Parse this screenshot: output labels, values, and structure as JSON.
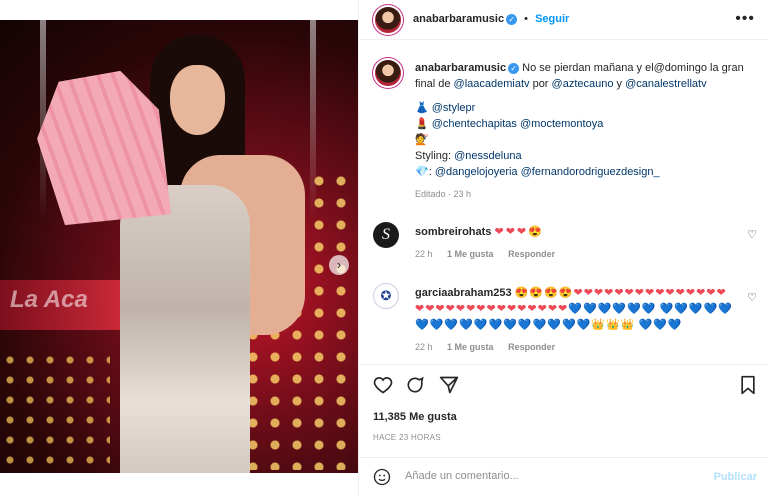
{
  "post": {
    "username": "anabarbaramusic",
    "follow_label": "Seguir",
    "more_icon": "more-horizontal-icon"
  },
  "caption": {
    "username": "anabarbaramusic",
    "text_parts": {
      "p1": "No se pierdan mañana y el@domingo la gran final de ",
      "m1": "@laacademiatv",
      "p2": " por ",
      "m2": "@aztecauno",
      "p3": " y ",
      "m3": "@canalestrellatv"
    },
    "line1_emoji": "👗",
    "line1_mention": "@stylepr",
    "line2_emoji": "💄",
    "line2_mention_a": "@chentechapitas",
    "line2_mention_b": "@moctemontoya",
    "line3_emoji": "💇",
    "styling_label": "Styling:",
    "styling_mention": "@nessdeluna",
    "line5_emoji": "💎",
    "line5_sep": ":",
    "line5_mention_a": "@dangelojoyeria",
    "line5_mention_b": "@fernandorodriguezdesign_",
    "edited": "Editado · 23 h"
  },
  "comments": [
    {
      "username": "sombreirohats",
      "text": "❤❤❤😍",
      "time": "22 h",
      "likes": "1 Me gusta",
      "reply": "Responder"
    },
    {
      "username": "garciaabraham253",
      "line1": "😍😍😍😍❤❤❤❤❤❤❤❤❤❤❤❤❤❤❤❤❤❤❤❤❤❤❤❤❤❤❤❤❤❤💙💙💙💙💙💙",
      "line2": "💙💙💙💙💙💙💙💙💙💙💙💙💙💙💙💙💙👑👑👑",
      "line3": "💙💙💙",
      "time": "22 h",
      "likes": "1 Me gusta",
      "reply": "Responder"
    }
  ],
  "actions": {
    "likes": "11,385 Me gusta",
    "posted_ago": "HACE 23 HORAS",
    "comment_placeholder": "Añade un comentario...",
    "publish_label": "Publicar"
  },
  "media": {
    "background_text": "La Aca",
    "carousel_count": 2,
    "active_slide": 1
  },
  "colors": {
    "link": "#00376b",
    "follow": "#0095f6",
    "publish_disabled": "#b2dffc",
    "like_red": "#ed4956"
  }
}
